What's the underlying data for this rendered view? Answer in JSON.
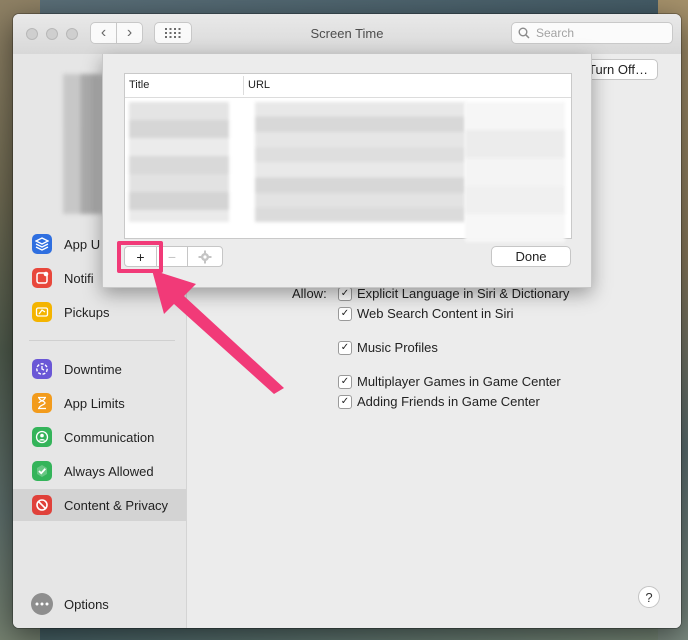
{
  "window": {
    "title": "Screen Time"
  },
  "search": {
    "placeholder": "Search"
  },
  "header": {
    "turn_off_label": "Turn Off…"
  },
  "sidebar": {
    "items": [
      {
        "label": "App U",
        "icon": "app-usage-icon",
        "color": "#2f6fe0"
      },
      {
        "label": "Notifi",
        "icon": "notifications-icon",
        "color": "#e8473b"
      },
      {
        "label": "Pickups",
        "icon": "pickups-icon",
        "color": "#f4b400"
      },
      {
        "label": "Downtime",
        "icon": "downtime-icon",
        "color": "#6a57d6"
      },
      {
        "label": "App Limits",
        "icon": "app-limits-icon",
        "color": "#f29b1c"
      },
      {
        "label": "Communication",
        "icon": "communication-icon",
        "color": "#34b45a"
      },
      {
        "label": "Always Allowed",
        "icon": "always-allowed-icon",
        "color": "#34b45a"
      },
      {
        "label": "Content & Privacy",
        "icon": "content-privacy-icon",
        "color": "#e0413a"
      }
    ],
    "options_label": "Options"
  },
  "main": {
    "allow_label": "Allow:",
    "checks": [
      {
        "label": "Explicit Language in Siri & Dictionary",
        "checked": true
      },
      {
        "label": "Web Search Content in Siri",
        "checked": true
      },
      {
        "label": "Music Profiles",
        "checked": true
      },
      {
        "label": "Multiplayer Games in Game Center",
        "checked": true
      },
      {
        "label": "Adding Friends in Game Center",
        "checked": true
      }
    ],
    "help_label": "?"
  },
  "sheet": {
    "columns": [
      "Title",
      "URL"
    ],
    "add_label": "+",
    "remove_label": "−",
    "done_label": "Done"
  },
  "annotation": {
    "color": "#f13a78"
  }
}
